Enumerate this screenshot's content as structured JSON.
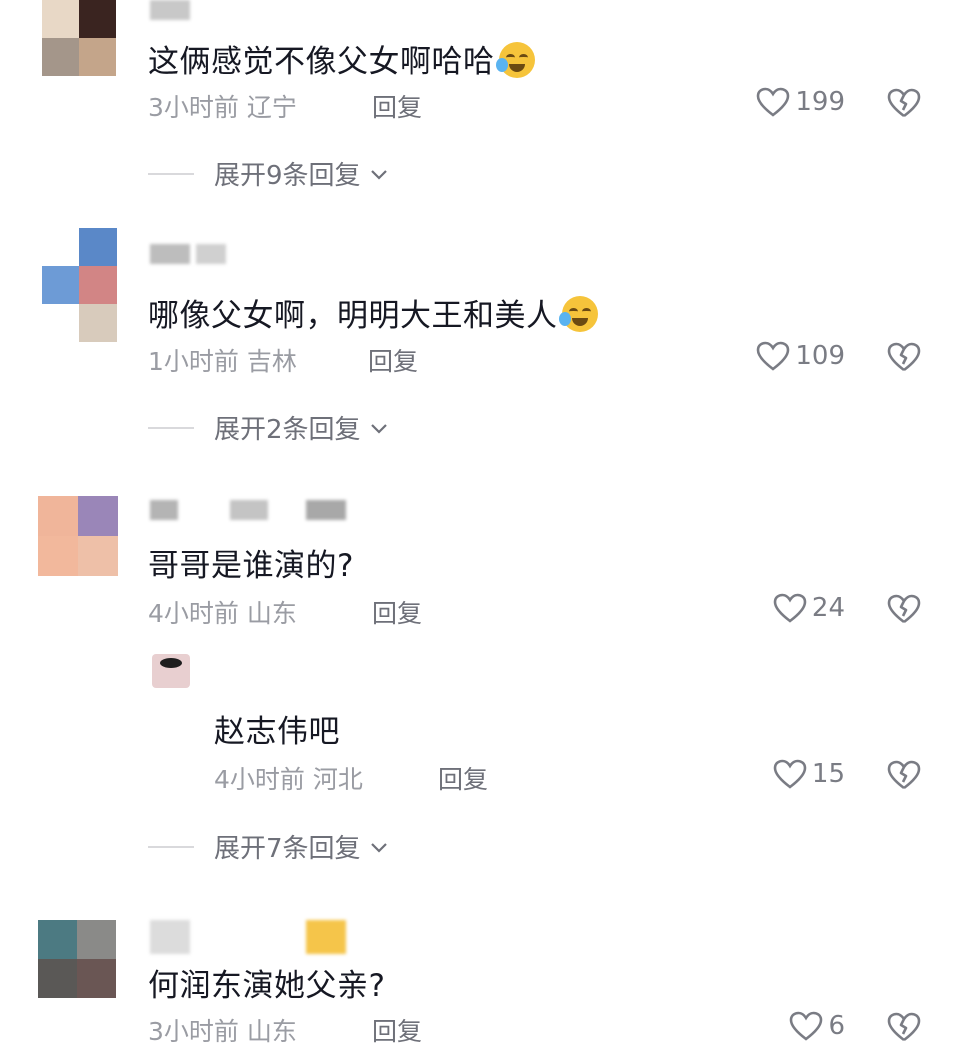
{
  "comments": [
    {
      "text": "这俩感觉不像父女啊哈哈",
      "time": "3小时前",
      "location": "辽宁",
      "reply": "回复",
      "likes": "199",
      "expand": "展开9条回复"
    },
    {
      "text": "哪像父女啊，明明大王和美人",
      "time": "1小时前",
      "location": "吉林",
      "reply": "回复",
      "likes": "109",
      "expand": "展开2条回复"
    },
    {
      "text": "哥哥是谁演的?",
      "time": "4小时前",
      "location": "山东",
      "reply": "回复",
      "likes": "24"
    },
    {
      "text": "何润东演她父亲?",
      "time": "3小时前",
      "location": "山东",
      "reply": "回复",
      "likes": "6"
    }
  ],
  "sub_reply": {
    "text": "赵志伟吧",
    "time": "4小时前",
    "location": "河北",
    "reply": "回复",
    "likes": "15",
    "expand": "展开7条回复"
  },
  "colors": {
    "text": "#161823",
    "meta": "#9a9ca3",
    "action": "#6e7079"
  }
}
